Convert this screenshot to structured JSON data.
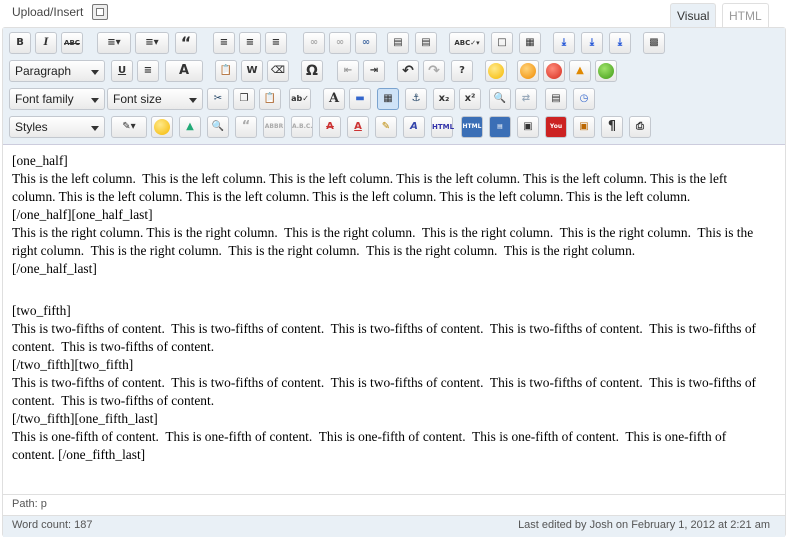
{
  "header": {
    "upload_label": "Upload/Insert",
    "tabs": [
      {
        "label": "Visual",
        "active": true
      },
      {
        "label": "HTML",
        "active": false
      }
    ]
  },
  "toolbar": {
    "format_select": "Paragraph",
    "font_family_select": "Font family",
    "font_size_select": "Font size",
    "styles_select": "Styles",
    "buttons_row1": [
      "bold-icon",
      "italic-icon",
      "strikethrough-icon",
      "bullet-list-icon",
      "numbered-list-icon",
      "blockquote-icon",
      "align-left-icon",
      "align-center-icon",
      "align-right-icon",
      "link-icon",
      "unlink-icon",
      "link-break-icon",
      "more-tag-icon",
      "page-break-icon",
      "spellcheck-icon",
      "fullscreen-icon",
      "kitchen-sink-icon",
      "insert-column-icon",
      "insert-column-alt-icon",
      "insert-column-last-icon",
      "media-icon"
    ],
    "labels": {
      "bold": "B",
      "italic": "I",
      "strike": "ABC",
      "quote": "“",
      "underline": "U",
      "textcolor": "A",
      "omega": "Ω",
      "help": "?",
      "sub": "x₂",
      "sup": "x²",
      "textA": "A",
      "html": "HTML",
      "pilcrow": "¶"
    }
  },
  "content": {
    "paragraphs": [
      "[one_half]",
      "This is the left column.  This is the left column. This is the left column. This is the left column. This is the left column. This is the left column. This is the left column. This is the left column. This is the left column. This is the left column. This is the left column.",
      "[/one_half][one_half_last]",
      "This is the right column. This is the right column.  This is the right column.  This is the right column.  This is the right column.  This is the right column.  This is the right column.  This is the right column.  This is the right column.  This is the right column.",
      "[/one_half_last]",
      "",
      "[two_fifth]",
      "This is two-fifths of content.  This is two-fifths of content.  This is two-fifths of content.  This is two-fifths of content.  This is two-fifths of content.  This is two-fifths of content.",
      "[/two_fifth][two_fifth]",
      "This is two-fifths of content.  This is two-fifths of content.  This is two-fifths of content.  This is two-fifths of content.  This is two-fifths of content.  This is two-fifths of content.",
      "[/two_fifth][one_fifth_last]",
      "This is one-fifth of content.  This is one-fifth of content.  This is one-fifth of content.  This is one-fifth of content.  This is one-fifth of content. [/one_fifth_last]"
    ]
  },
  "path": "Path: p",
  "status": {
    "word_count": "Word count: 187",
    "last_edited": "Last edited by Josh on February 1, 2012 at 2:21 am"
  }
}
